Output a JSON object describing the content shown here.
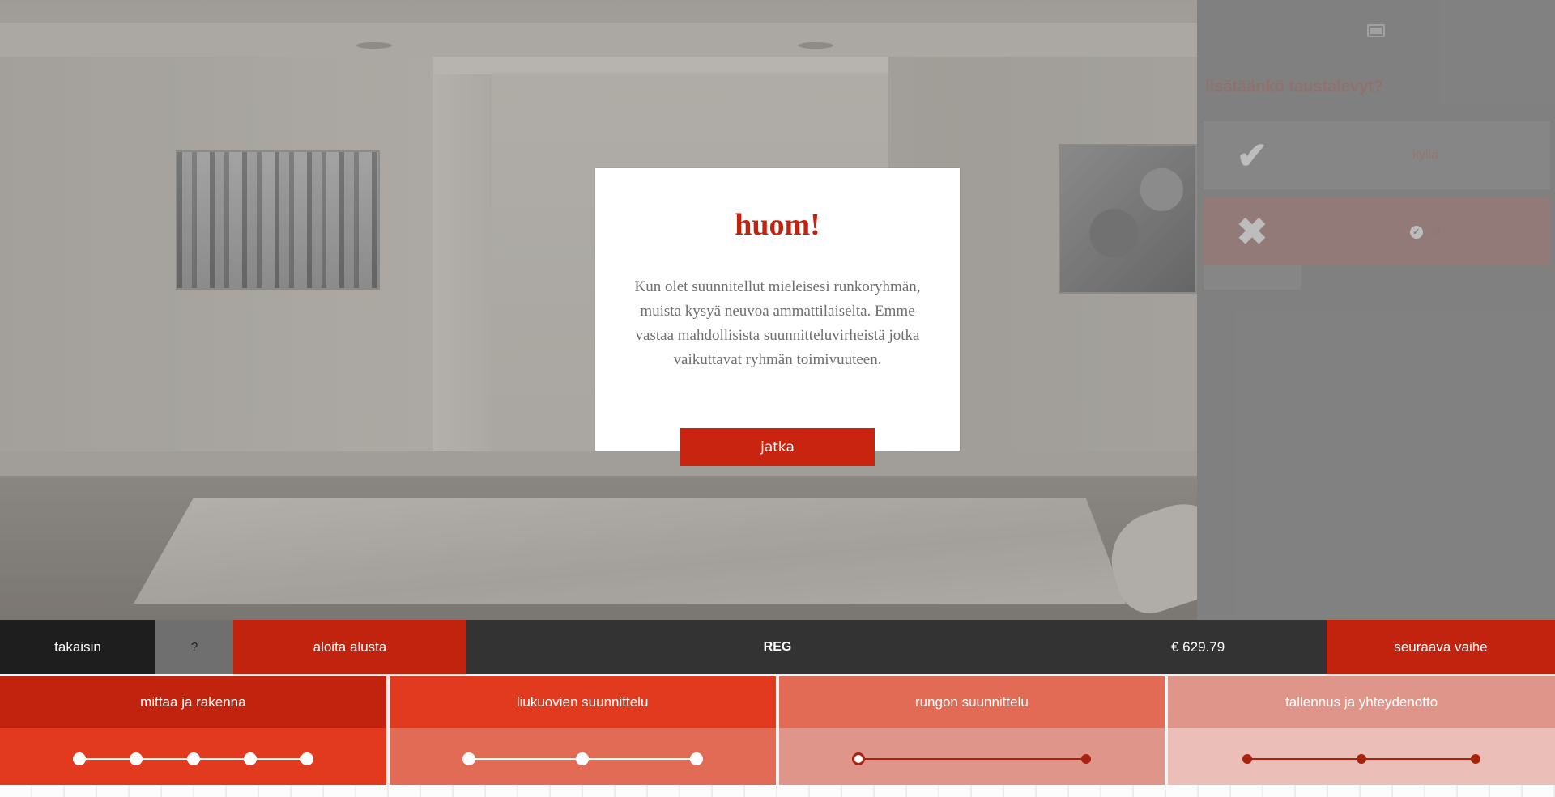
{
  "viewport": {
    "label": ""
  },
  "side_panel": {
    "question": "lisätäänkö taustalevyt?",
    "options": [
      {
        "label": "kyllä",
        "icon": "check-icon"
      },
      {
        "label": "ei",
        "icon": "close-icon",
        "selected": true
      }
    ]
  },
  "modal": {
    "title": "huom!",
    "body": "Kun olet suunnitellut mieleisesi runkoryhmän, muista kysyä neuvoa ammattilaiselta. Emme vastaa mahdollisista suunnitteluvirheistä jotka vaikuttavat ryhmän toimivuuteen.",
    "button_label": "jatka"
  },
  "toolbar": {
    "back_label": "takaisin",
    "help_label": "?",
    "reset_label": "aloita alusta",
    "model_label": "REG",
    "price": "€ 629.79",
    "next_label": "seuraava vaihe"
  },
  "steps": [
    {
      "label": "mittaa ja rakenna",
      "substeps": 5,
      "state": "done"
    },
    {
      "label": "liukuovien suunnittelu",
      "substeps": 3,
      "state": "done"
    },
    {
      "label": "rungon suunnittelu",
      "substeps": 2,
      "state": "current",
      "current_index": 0
    },
    {
      "label": "tallennus ja yhteydenotto",
      "substeps": 3,
      "state": "todo"
    }
  ],
  "colors": {
    "accent": "#c2230f",
    "accent_light": "#e23a1f",
    "toolbar_bg": "#333333"
  }
}
